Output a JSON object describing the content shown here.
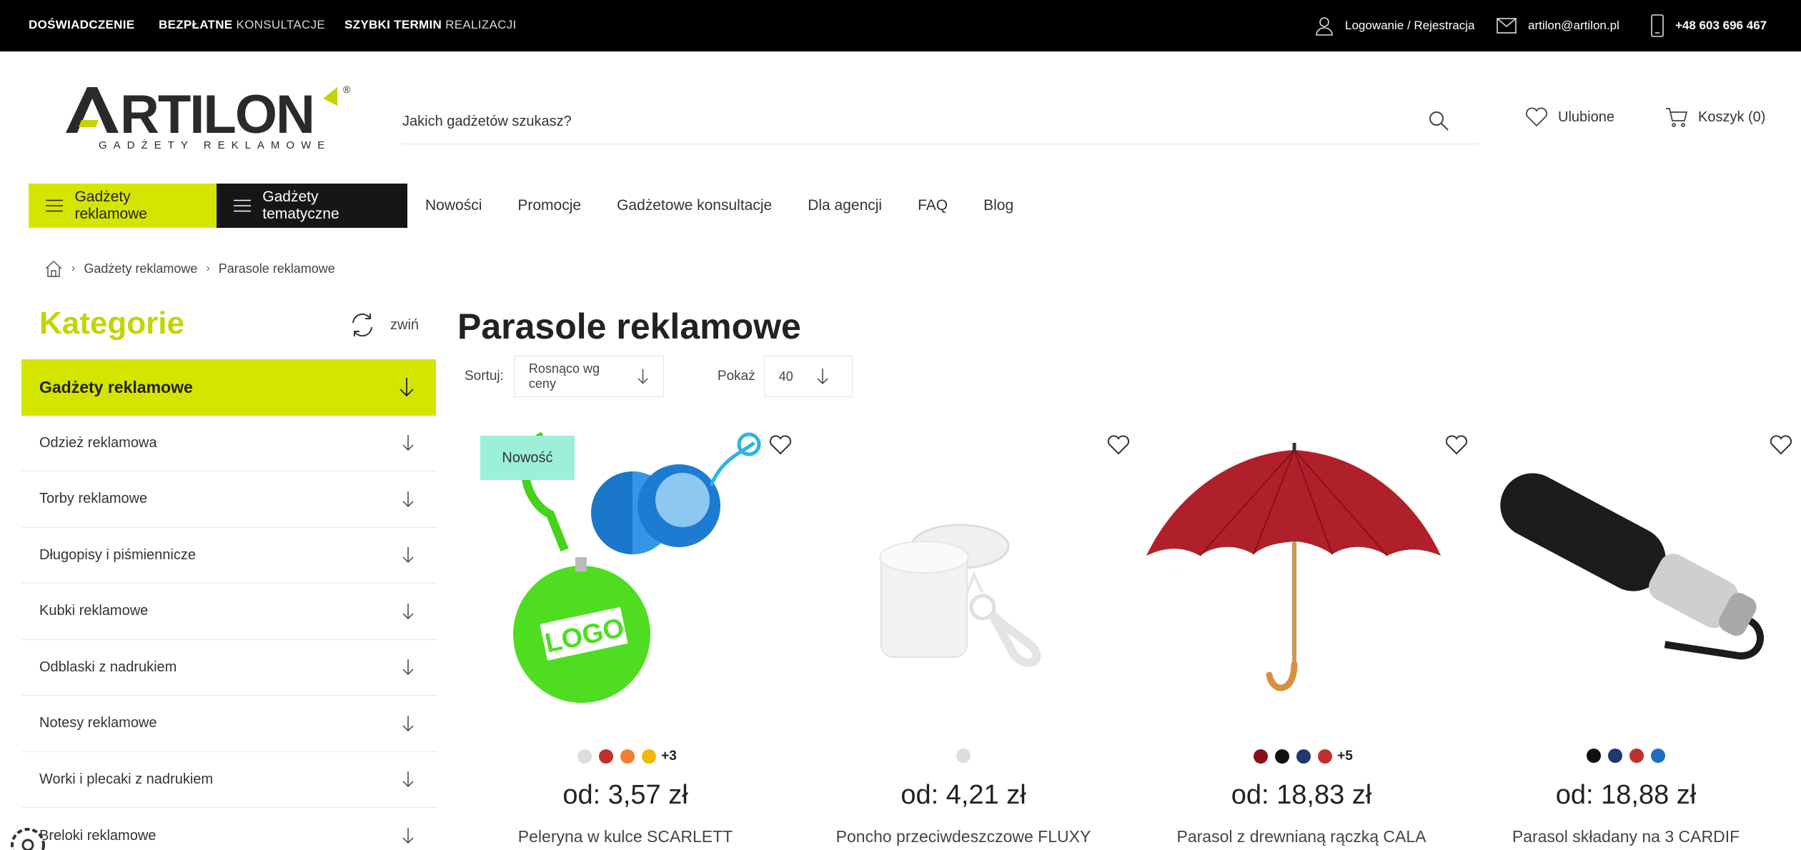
{
  "topbar": {
    "promo1": {
      "bold": "DOŚWIADCZENIE",
      "light": ""
    },
    "promo2": {
      "bold": "BEZPŁATNE",
      "light": "KONSULTACJE"
    },
    "promo3": {
      "bold": "SZYBKI TERMIN",
      "light": "REALIZACJI"
    },
    "login": "Logowanie / Rejestracja",
    "email": "artilon@artilon.pl",
    "phone": "+48 603 696 467"
  },
  "logo": {
    "name": "ARTILON",
    "tagline": "GADŻETY REKLAMOWE",
    "registered": "®"
  },
  "search": {
    "placeholder": "Jakich gadżetów szukasz?"
  },
  "header": {
    "favorites": "Ulubione",
    "cart": "Koszyk (0)"
  },
  "nav": {
    "gadgets": "Gadżety reklamowe",
    "thematic": "Gadżety tematyczne",
    "links": [
      "Nowości",
      "Promocje",
      "Gadżetowe konsultacje",
      "Dla agencji",
      "FAQ",
      "Blog"
    ]
  },
  "breadcrumb": {
    "level1": "Gadżety reklamowe",
    "level2": "Parasole reklamowe"
  },
  "sidebar": {
    "title": "Kategorie",
    "collapse": "zwiń",
    "active": "Gadżety reklamowe",
    "items": [
      "Odzież reklamowa",
      "Torby reklamowe",
      "Długopisy i piśmiennicze",
      "Kubki reklamowe",
      "Odblaski z nadrukiem",
      "Notesy reklamowe",
      "Worki i plecaki z nadrukiem",
      "Breloki reklamowe"
    ]
  },
  "main": {
    "title": "Parasole reklamowe",
    "sort_label": "Sortuj:",
    "sort_value": "Rosnąco wg ceny",
    "show_label": "Pokaż",
    "show_value": "40"
  },
  "products": [
    {
      "name": "Peleryna w kulce SCARLETT",
      "price": "od: 3,57 zł",
      "badge": "Nowość",
      "colors": [
        "#dddddd",
        "#c0302c",
        "#f08030",
        "#f5b800"
      ],
      "more": "+3"
    },
    {
      "name": "Poncho przeciwdeszczowe FLUXY",
      "price": "od: 4,21 zł",
      "badge": "",
      "colors": [
        "#dddddd"
      ],
      "more": ""
    },
    {
      "name": "Parasol z drewnianą rączką CALA",
      "price": "od: 18,83 zł",
      "badge": "",
      "colors": [
        "#8a1018",
        "#111111",
        "#1d3a6e",
        "#c0302c"
      ],
      "more": "+5"
    },
    {
      "name": "Parasol składany na 3 CARDIF",
      "price": "od: 18,88 zł",
      "badge": "",
      "colors": [
        "#111111",
        "#1d3a6e",
        "#c0302c",
        "#1e6fc0"
      ],
      "more": ""
    }
  ],
  "colors": {
    "accent": "#d4e600",
    "accent_text": "#c3d400",
    "badge": "#9cf0d8",
    "topbar": "#000000"
  }
}
